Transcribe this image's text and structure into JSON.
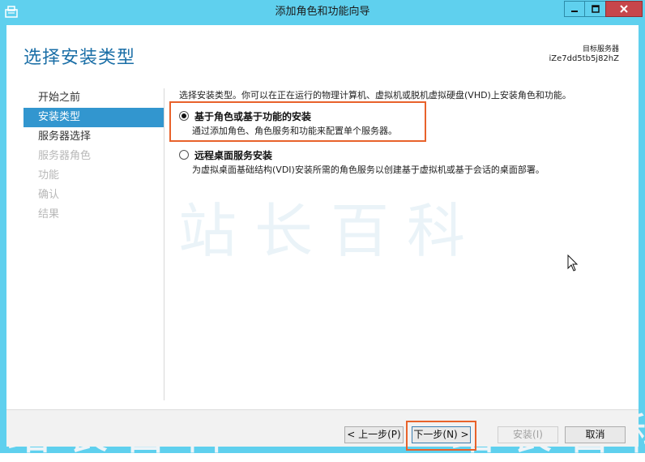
{
  "window": {
    "title": "添加角色和功能向导",
    "icons": {
      "app": "wizard-app-icon",
      "minimize": "minimize-icon",
      "maximize": "maximize-icon",
      "close": "close-icon"
    }
  },
  "header": {
    "page_title": "选择安装类型",
    "target_server_label": "目标服务器",
    "target_server_name": "iZe7dd5tb5j82hZ"
  },
  "nav": {
    "items": [
      {
        "label": "开始之前",
        "state": "normal"
      },
      {
        "label": "安装类型",
        "state": "active"
      },
      {
        "label": "服务器选择",
        "state": "normal"
      },
      {
        "label": "服务器角色",
        "state": "disabled"
      },
      {
        "label": "功能",
        "state": "disabled"
      },
      {
        "label": "确认",
        "state": "disabled"
      },
      {
        "label": "结果",
        "state": "disabled"
      }
    ]
  },
  "main": {
    "intro": "选择安装类型。你可以在正在运行的物理计算机、虚拟机或脱机虚拟硬盘(VHD)上安装角色和功能。",
    "options": [
      {
        "title": "基于角色或基于功能的安装",
        "description": "通过添加角色、角色服务和功能来配置单个服务器。",
        "selected": true
      },
      {
        "title": "远程桌面服务安装",
        "description": "为虚拟桌面基础结构(VDI)安装所需的角色服务以创建基于虚拟机或基于会话的桌面部署。",
        "selected": false
      }
    ]
  },
  "watermark": {
    "text": "站长百科"
  },
  "footer": {
    "prev_label": "< 上一步(P)",
    "next_label": "下一步(N) >",
    "install_label": "安装(I)",
    "cancel_label": "取消"
  },
  "colors": {
    "titlebar": "#5fd0ee",
    "accent": "#3296cf",
    "page_title": "#1b6fa7",
    "highlight": "#e8622b"
  }
}
